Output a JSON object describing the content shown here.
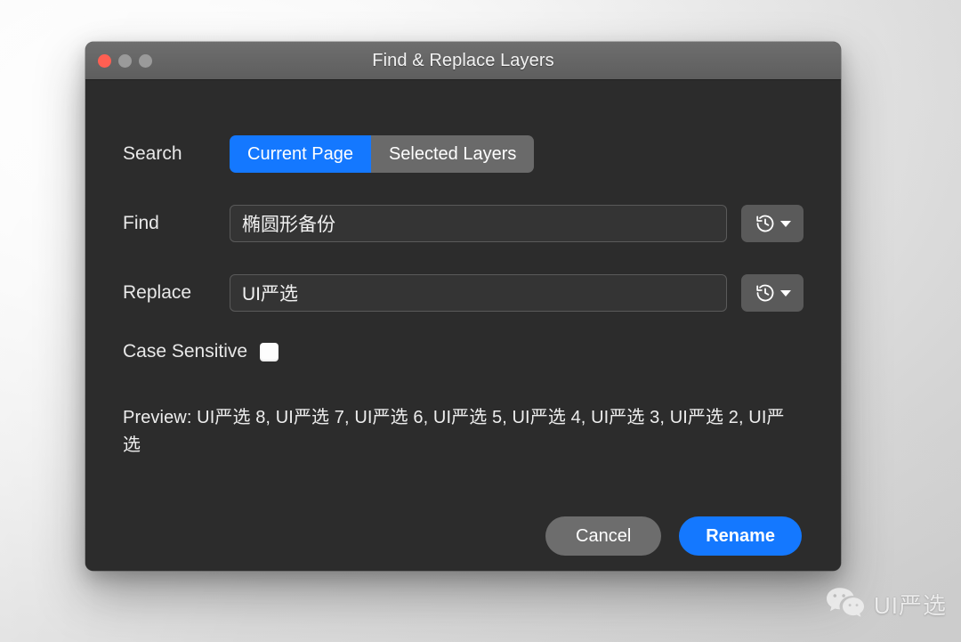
{
  "window": {
    "title": "Find & Replace Layers",
    "traffic_lights": [
      {
        "name": "close",
        "color": "#ff5f52"
      },
      {
        "name": "minimize",
        "color": "#9a9a9a"
      },
      {
        "name": "maximize",
        "color": "#9a9a9a"
      }
    ]
  },
  "search": {
    "label": "Search",
    "options": [
      "Current Page",
      "Selected Layers"
    ],
    "selected": "Current Page"
  },
  "find": {
    "label": "Find",
    "value": "椭圆形备份",
    "placeholder": "",
    "history_icon": "history-clock-icon"
  },
  "replace": {
    "label": "Replace",
    "value": "UI严选",
    "placeholder": "",
    "history_icon": "history-clock-icon"
  },
  "case_sensitive": {
    "label": "Case Sensitive",
    "checked": false
  },
  "preview": {
    "text": "Preview: UI严选 8, UI严选 7, UI严选 6, UI严选 5, UI严选 4, UI严选 3, UI严选 2, UI严选"
  },
  "footer": {
    "cancel_label": "Cancel",
    "rename_label": "Rename"
  },
  "watermark": {
    "text": "UI严选",
    "icon": "wechat-icon"
  },
  "colors": {
    "accent": "#1478ff",
    "window_body": "#2c2c2c",
    "titlebar": "#666666",
    "field_bg": "#343434",
    "segment_inactive": "#6a6a6a",
    "cancel_bg": "#6d6d6d",
    "close_light": "#ff5f52"
  }
}
